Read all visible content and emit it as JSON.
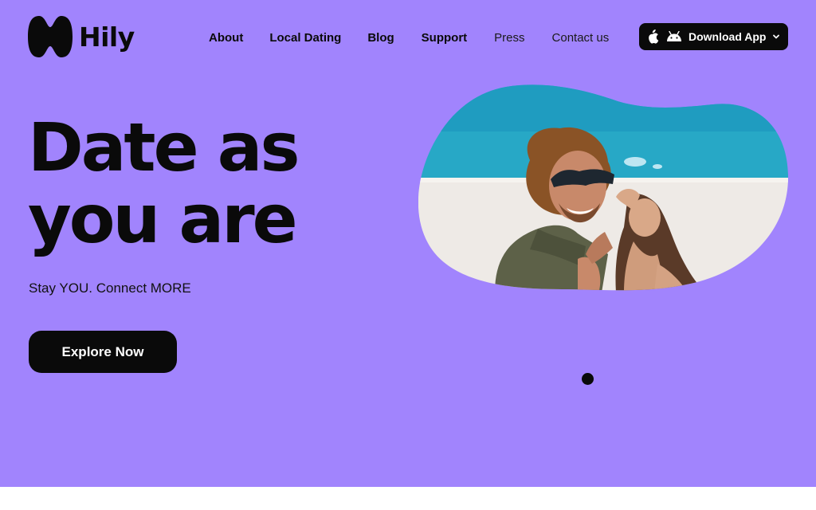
{
  "brand": {
    "name": "Hily"
  },
  "nav": {
    "items": [
      {
        "label": "About"
      },
      {
        "label": "Local Dating"
      },
      {
        "label": "Blog"
      },
      {
        "label": "Support"
      },
      {
        "label": "Press"
      },
      {
        "label": "Contact us"
      }
    ]
  },
  "download": {
    "label": "Download App",
    "icons": [
      "apple-icon",
      "android-icon",
      "chevron-down-icon"
    ]
  },
  "hero": {
    "headline_line1": "Date as",
    "headline_line2": "you are",
    "subline": "Stay YOU. Connect MORE",
    "cta_label": "Explore Now"
  },
  "carousel": {
    "active_index": 1,
    "total": 1
  },
  "colors": {
    "hero_background": "#a184fd",
    "text": "#0a0a0a",
    "button_background": "#0a0a0a",
    "button_text": "#ffffff"
  }
}
